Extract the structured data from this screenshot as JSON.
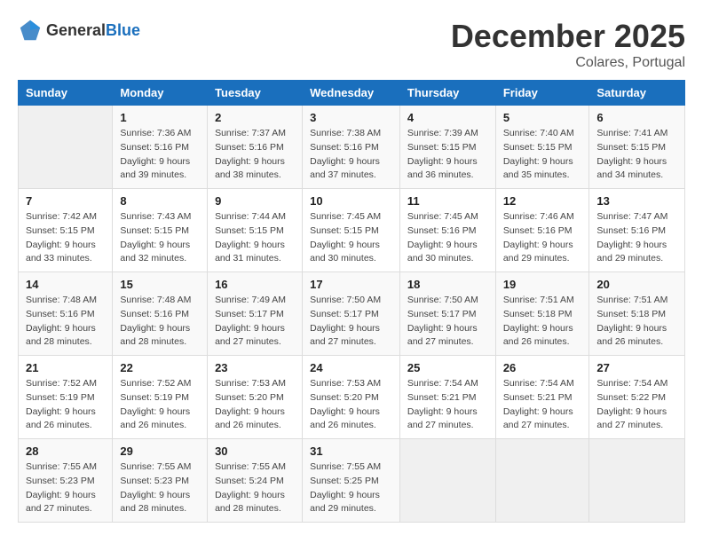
{
  "header": {
    "logo_general": "General",
    "logo_blue": "Blue",
    "month_title": "December 2025",
    "location": "Colares, Portugal"
  },
  "columns": [
    "Sunday",
    "Monday",
    "Tuesday",
    "Wednesday",
    "Thursday",
    "Friday",
    "Saturday"
  ],
  "weeks": [
    [
      {
        "day": "",
        "info": ""
      },
      {
        "day": "1",
        "info": "Sunrise: 7:36 AM\nSunset: 5:16 PM\nDaylight: 9 hours\nand 39 minutes."
      },
      {
        "day": "2",
        "info": "Sunrise: 7:37 AM\nSunset: 5:16 PM\nDaylight: 9 hours\nand 38 minutes."
      },
      {
        "day": "3",
        "info": "Sunrise: 7:38 AM\nSunset: 5:16 PM\nDaylight: 9 hours\nand 37 minutes."
      },
      {
        "day": "4",
        "info": "Sunrise: 7:39 AM\nSunset: 5:15 PM\nDaylight: 9 hours\nand 36 minutes."
      },
      {
        "day": "5",
        "info": "Sunrise: 7:40 AM\nSunset: 5:15 PM\nDaylight: 9 hours\nand 35 minutes."
      },
      {
        "day": "6",
        "info": "Sunrise: 7:41 AM\nSunset: 5:15 PM\nDaylight: 9 hours\nand 34 minutes."
      }
    ],
    [
      {
        "day": "7",
        "info": "Sunrise: 7:42 AM\nSunset: 5:15 PM\nDaylight: 9 hours\nand 33 minutes."
      },
      {
        "day": "8",
        "info": "Sunrise: 7:43 AM\nSunset: 5:15 PM\nDaylight: 9 hours\nand 32 minutes."
      },
      {
        "day": "9",
        "info": "Sunrise: 7:44 AM\nSunset: 5:15 PM\nDaylight: 9 hours\nand 31 minutes."
      },
      {
        "day": "10",
        "info": "Sunrise: 7:45 AM\nSunset: 5:15 PM\nDaylight: 9 hours\nand 30 minutes."
      },
      {
        "day": "11",
        "info": "Sunrise: 7:45 AM\nSunset: 5:16 PM\nDaylight: 9 hours\nand 30 minutes."
      },
      {
        "day": "12",
        "info": "Sunrise: 7:46 AM\nSunset: 5:16 PM\nDaylight: 9 hours\nand 29 minutes."
      },
      {
        "day": "13",
        "info": "Sunrise: 7:47 AM\nSunset: 5:16 PM\nDaylight: 9 hours\nand 29 minutes."
      }
    ],
    [
      {
        "day": "14",
        "info": "Sunrise: 7:48 AM\nSunset: 5:16 PM\nDaylight: 9 hours\nand 28 minutes."
      },
      {
        "day": "15",
        "info": "Sunrise: 7:48 AM\nSunset: 5:16 PM\nDaylight: 9 hours\nand 28 minutes."
      },
      {
        "day": "16",
        "info": "Sunrise: 7:49 AM\nSunset: 5:17 PM\nDaylight: 9 hours\nand 27 minutes."
      },
      {
        "day": "17",
        "info": "Sunrise: 7:50 AM\nSunset: 5:17 PM\nDaylight: 9 hours\nand 27 minutes."
      },
      {
        "day": "18",
        "info": "Sunrise: 7:50 AM\nSunset: 5:17 PM\nDaylight: 9 hours\nand 27 minutes."
      },
      {
        "day": "19",
        "info": "Sunrise: 7:51 AM\nSunset: 5:18 PM\nDaylight: 9 hours\nand 26 minutes."
      },
      {
        "day": "20",
        "info": "Sunrise: 7:51 AM\nSunset: 5:18 PM\nDaylight: 9 hours\nand 26 minutes."
      }
    ],
    [
      {
        "day": "21",
        "info": "Sunrise: 7:52 AM\nSunset: 5:19 PM\nDaylight: 9 hours\nand 26 minutes."
      },
      {
        "day": "22",
        "info": "Sunrise: 7:52 AM\nSunset: 5:19 PM\nDaylight: 9 hours\nand 26 minutes."
      },
      {
        "day": "23",
        "info": "Sunrise: 7:53 AM\nSunset: 5:20 PM\nDaylight: 9 hours\nand 26 minutes."
      },
      {
        "day": "24",
        "info": "Sunrise: 7:53 AM\nSunset: 5:20 PM\nDaylight: 9 hours\nand 26 minutes."
      },
      {
        "day": "25",
        "info": "Sunrise: 7:54 AM\nSunset: 5:21 PM\nDaylight: 9 hours\nand 27 minutes."
      },
      {
        "day": "26",
        "info": "Sunrise: 7:54 AM\nSunset: 5:21 PM\nDaylight: 9 hours\nand 27 minutes."
      },
      {
        "day": "27",
        "info": "Sunrise: 7:54 AM\nSunset: 5:22 PM\nDaylight: 9 hours\nand 27 minutes."
      }
    ],
    [
      {
        "day": "28",
        "info": "Sunrise: 7:55 AM\nSunset: 5:23 PM\nDaylight: 9 hours\nand 27 minutes."
      },
      {
        "day": "29",
        "info": "Sunrise: 7:55 AM\nSunset: 5:23 PM\nDaylight: 9 hours\nand 28 minutes."
      },
      {
        "day": "30",
        "info": "Sunrise: 7:55 AM\nSunset: 5:24 PM\nDaylight: 9 hours\nand 28 minutes."
      },
      {
        "day": "31",
        "info": "Sunrise: 7:55 AM\nSunset: 5:25 PM\nDaylight: 9 hours\nand 29 minutes."
      },
      {
        "day": "",
        "info": ""
      },
      {
        "day": "",
        "info": ""
      },
      {
        "day": "",
        "info": ""
      }
    ]
  ]
}
